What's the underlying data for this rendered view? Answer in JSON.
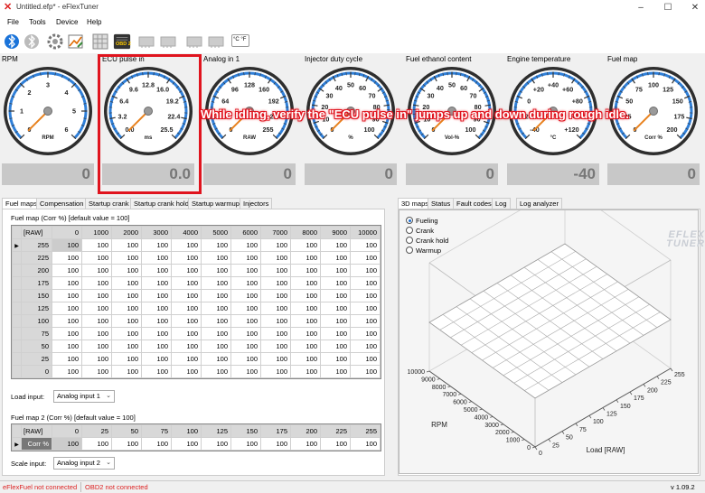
{
  "window": {
    "title": "Untitled.efp* - eFlexTuner"
  },
  "menu": [
    "File",
    "Tools",
    "Device",
    "Help"
  ],
  "toolbar": {
    "obd_label": "OBD 2",
    "units_label": "°C °F"
  },
  "gauges": [
    {
      "title": "RPM",
      "ticks": [
        "0",
        "1",
        "2",
        "3",
        "4",
        "5",
        "6"
      ],
      "unit": "RPM",
      "value": "0"
    },
    {
      "title": "ECU pulse in",
      "ticks": [
        "0.0",
        "3.2",
        "6.4",
        "9.6",
        "12.8",
        "16.0",
        "19.2",
        "22.4",
        "25.5"
      ],
      "unit": "ms",
      "value": "0.0"
    },
    {
      "title": "Analog in 1",
      "ticks": [
        "0",
        "32",
        "64",
        "96",
        "128",
        "160",
        "192",
        "224",
        "255"
      ],
      "unit": "RAW",
      "value": "0"
    },
    {
      "title": "Injector duty cycle",
      "ticks": [
        "0",
        "10",
        "20",
        "30",
        "40",
        "50",
        "60",
        "70",
        "80",
        "90",
        "100"
      ],
      "unit": "%",
      "value": "0"
    },
    {
      "title": "Fuel ethanol content",
      "ticks": [
        "0",
        "10",
        "20",
        "30",
        "40",
        "50",
        "60",
        "70",
        "80",
        "90",
        "100"
      ],
      "unit": "Vol-%",
      "value": "0"
    },
    {
      "title": "Engine temperature",
      "ticks": [
        "-40",
        "-20",
        "0",
        "+20",
        "+40",
        "+60",
        "+80",
        "+100",
        "+120"
      ],
      "unit": "°C",
      "value": "-40"
    },
    {
      "title": "Fuel map",
      "ticks": [
        "0",
        "25",
        "50",
        "75",
        "100",
        "125",
        "150",
        "175",
        "200"
      ],
      "unit": "Corr %",
      "value": "0"
    }
  ],
  "annotation": "While idling, verify the \"ECU pulse in\" jumps up and down during rough idle.",
  "left_tabs": [
    "Fuel maps",
    "Compensation",
    "Startup crank",
    "Startup crank hold",
    "Startup warmup",
    "Injectors"
  ],
  "right_tabs": [
    "3D maps",
    "Status",
    "Fault codes",
    "Log",
    "Log analyzer"
  ],
  "fuel_map": {
    "label": "Fuel map (Corr %) [default value = 100]",
    "corner": "[RAW]",
    "columns": [
      "0",
      "1000",
      "2000",
      "3000",
      "4000",
      "5000",
      "6000",
      "7000",
      "8000",
      "9000",
      "10000"
    ],
    "rows": [
      {
        "head": "255",
        "cells": [
          "100",
          "100",
          "100",
          "100",
          "100",
          "100",
          "100",
          "100",
          "100",
          "100",
          "100"
        ]
      },
      {
        "head": "225",
        "cells": [
          "100",
          "100",
          "100",
          "100",
          "100",
          "100",
          "100",
          "100",
          "100",
          "100",
          "100"
        ]
      },
      {
        "head": "200",
        "cells": [
          "100",
          "100",
          "100",
          "100",
          "100",
          "100",
          "100",
          "100",
          "100",
          "100",
          "100"
        ]
      },
      {
        "head": "175",
        "cells": [
          "100",
          "100",
          "100",
          "100",
          "100",
          "100",
          "100",
          "100",
          "100",
          "100",
          "100"
        ]
      },
      {
        "head": "150",
        "cells": [
          "100",
          "100",
          "100",
          "100",
          "100",
          "100",
          "100",
          "100",
          "100",
          "100",
          "100"
        ]
      },
      {
        "head": "125",
        "cells": [
          "100",
          "100",
          "100",
          "100",
          "100",
          "100",
          "100",
          "100",
          "100",
          "100",
          "100"
        ]
      },
      {
        "head": "100",
        "cells": [
          "100",
          "100",
          "100",
          "100",
          "100",
          "100",
          "100",
          "100",
          "100",
          "100",
          "100"
        ]
      },
      {
        "head": "75",
        "cells": [
          "100",
          "100",
          "100",
          "100",
          "100",
          "100",
          "100",
          "100",
          "100",
          "100",
          "100"
        ]
      },
      {
        "head": "50",
        "cells": [
          "100",
          "100",
          "100",
          "100",
          "100",
          "100",
          "100",
          "100",
          "100",
          "100",
          "100"
        ]
      },
      {
        "head": "25",
        "cells": [
          "100",
          "100",
          "100",
          "100",
          "100",
          "100",
          "100",
          "100",
          "100",
          "100",
          "100"
        ]
      },
      {
        "head": "0",
        "cells": [
          "100",
          "100",
          "100",
          "100",
          "100",
          "100",
          "100",
          "100",
          "100",
          "100",
          "100"
        ]
      }
    ]
  },
  "load_input": {
    "label": "Load input:",
    "value": "Analog input 1"
  },
  "fuel_map2": {
    "label": "Fuel map 2 (Corr %) [default value = 100]",
    "corner": "[RAW]",
    "columns": [
      "0",
      "25",
      "50",
      "75",
      "100",
      "125",
      "150",
      "175",
      "200",
      "225",
      "255"
    ],
    "row_head": "Corr %",
    "cells": [
      "100",
      "100",
      "100",
      "100",
      "100",
      "100",
      "100",
      "100",
      "100",
      "100",
      "100"
    ]
  },
  "scale_input": {
    "label": "Scale input:",
    "value": "Analog input 2"
  },
  "map3d": {
    "options": [
      "Fueling",
      "Crank",
      "Crank hold",
      "Warmup"
    ],
    "selected": 0,
    "logo": "EFLEX TUNER",
    "rpm_label": "RPM",
    "load_label": "Load [RAW]",
    "rpm_ticks": [
      "0",
      "1000",
      "2000",
      "3000",
      "4000",
      "5000",
      "6000",
      "7000",
      "8000",
      "9000",
      "10000"
    ],
    "load_ticks": [
      "0",
      "25",
      "50",
      "75",
      "100",
      "125",
      "150",
      "175",
      "200",
      "225",
      "255"
    ]
  },
  "status": {
    "eflexfuel": "eFlexFuel not connected",
    "obd2": "OBD2 not connected",
    "version": "v 1.09.2"
  }
}
